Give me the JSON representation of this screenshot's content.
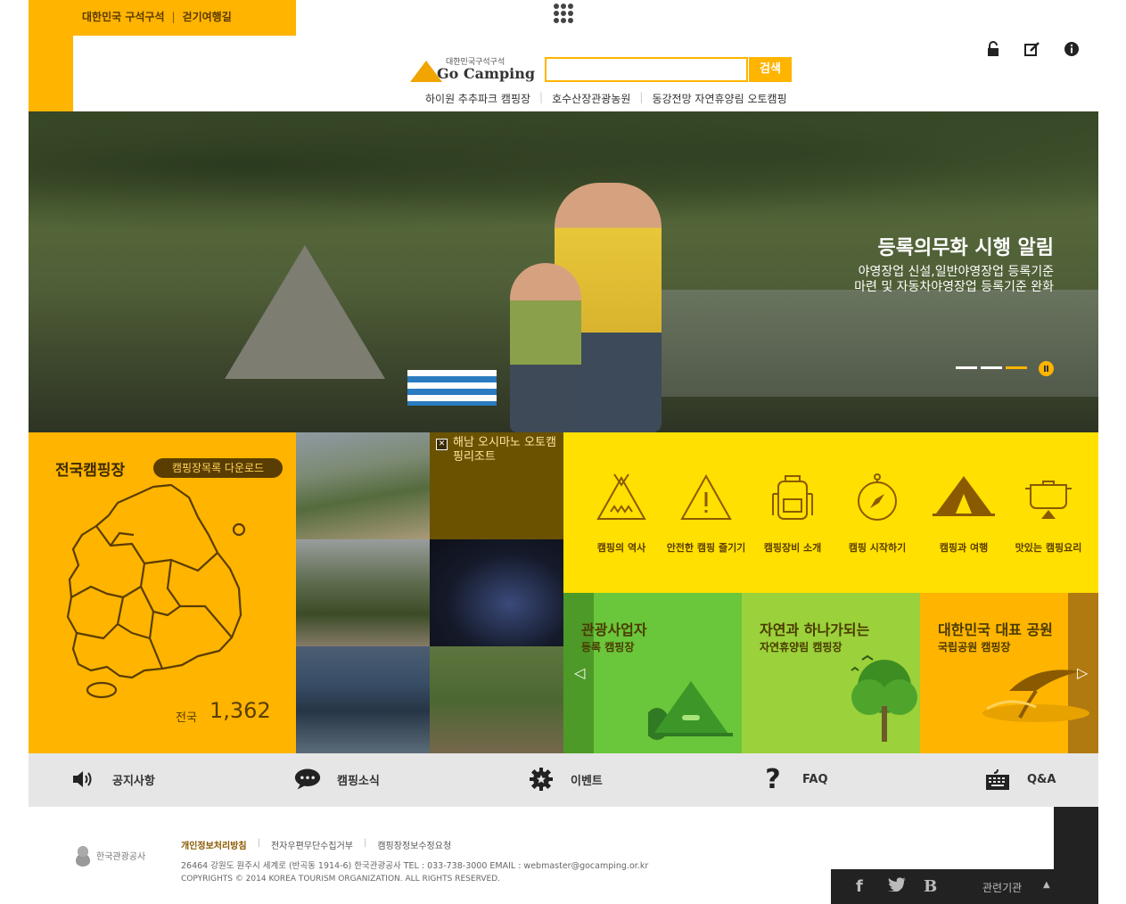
{
  "top_bar": {
    "link1": "대한민국 구석구석",
    "link2": "걷기여행길"
  },
  "header": {
    "logo_small": "대한민국구석구석",
    "logo_big": "Go Camping",
    "search_placeholder": "",
    "search_button": "검색",
    "quick_links": [
      "하이원 추추파크 캠핑장",
      "호수산장관광농원",
      "동강전망 자연휴양림 오토캠핑"
    ],
    "top_icons": [
      "lock-icon",
      "edit-icon",
      "info-icon"
    ]
  },
  "hero": {
    "title": "등록의무화 시행 알림",
    "subtitle_line1": "야영장업 신설,일반야영장업 등록기준",
    "subtitle_line2": "마련 및 자동차야영장업 등록기준 완화",
    "slide_count": 3,
    "active_slide": 3
  },
  "map_panel": {
    "title": "전국캠핑장",
    "download_button": "캠핑장목록 다운로드",
    "count_label": "전국",
    "count": "1,362"
  },
  "photos": {
    "featured_title": "해남 오시마노 오토캠핑리조트"
  },
  "icon_menu": [
    {
      "label": "캠핑의 역사",
      "icon": "tent-icon"
    },
    {
      "label": "안전한 캠핑 즐기기",
      "icon": "warning-icon"
    },
    {
      "label": "캠핑장비 소개",
      "icon": "backpack-icon"
    },
    {
      "label": "캠핑 시작하기",
      "icon": "compass-icon"
    },
    {
      "label": "캠핑과 여행",
      "icon": "camping-tent-icon"
    },
    {
      "label": "맛있는 캠핑요리",
      "icon": "pot-icon"
    }
  ],
  "tiles": [
    {
      "title": "관광사업자",
      "subtitle": "등록 캠핑장"
    },
    {
      "title": "자연과 하나가되는",
      "subtitle": "자연휴양림 캠핑장"
    },
    {
      "title": "대한민국 대표 공원",
      "subtitle": "국립공원 캠핑장"
    }
  ],
  "bottom_nav": [
    {
      "label": "공지사항",
      "icon": "speaker-icon"
    },
    {
      "label": "캠핑소식",
      "icon": "chat-icon"
    },
    {
      "label": "이벤트",
      "icon": "gear-icon"
    },
    {
      "label": "FAQ",
      "icon": "question-icon"
    },
    {
      "label": "Q&A",
      "icon": "keyboard-icon"
    }
  ],
  "footer": {
    "org_logo": "한국관광공사",
    "links": [
      "개인정보처리방침",
      "전자우편무단수집거부",
      "캠핑장정보수정요청"
    ],
    "address": "26464  강원도 원주시 세계로 (반곡동 1914-6) 한국관광공사    TEL : 033-738-3000   EMAIL : webmaster@gocamping.or.kr",
    "copyright": "COPYRIGHTS © 2014 KOREA TOURISM ORGANIZATION. ALL RIGHTS RESERVED.",
    "social": [
      "f",
      "t",
      "B"
    ],
    "related": "관련기관"
  },
  "colors": {
    "brand_orange": "#ffb400",
    "icon_yellow": "#ffe000",
    "green": "#6ac63a",
    "light_green": "#9bd13a"
  }
}
